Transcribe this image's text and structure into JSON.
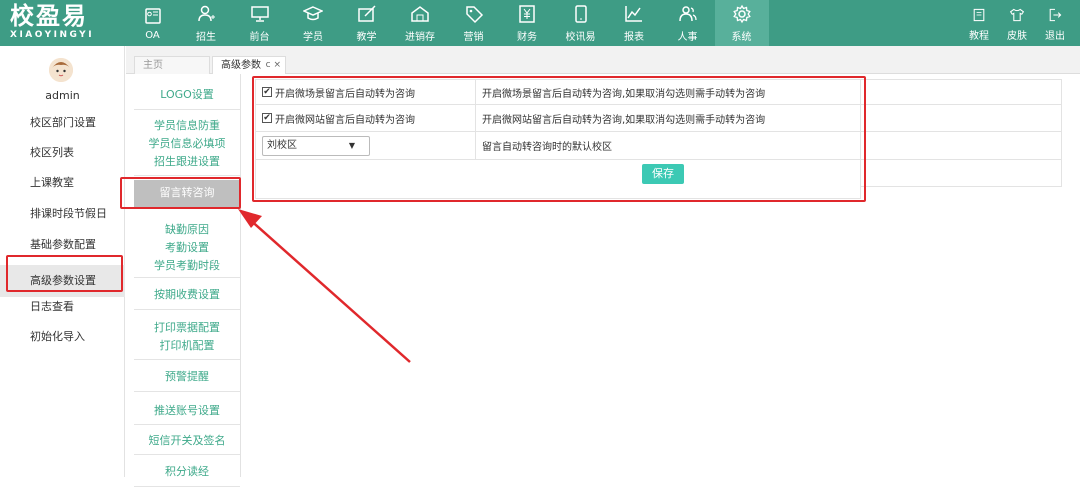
{
  "brand": {
    "name": "校盈易",
    "sub": "XIAOYINGYI"
  },
  "nav": [
    {
      "label": "OA",
      "icon": "id-card-icon"
    },
    {
      "label": "招生",
      "icon": "user-add-icon"
    },
    {
      "label": "前台",
      "icon": "monitor-icon"
    },
    {
      "label": "学员",
      "icon": "graduation-cap-icon"
    },
    {
      "label": "教学",
      "icon": "pencil-board-icon"
    },
    {
      "label": "进销存",
      "icon": "warehouse-icon"
    },
    {
      "label": "营销",
      "icon": "tag-icon"
    },
    {
      "label": "财务",
      "icon": "yen-icon"
    },
    {
      "label": "校讯易",
      "icon": "phone-icon"
    },
    {
      "label": "报表",
      "icon": "line-chart-icon"
    },
    {
      "label": "人事",
      "icon": "people-icon"
    },
    {
      "label": "系统",
      "icon": "gear-icon"
    }
  ],
  "tools": [
    {
      "label": "教程",
      "icon": "book-icon"
    },
    {
      "label": "皮肤",
      "icon": "shirt-icon"
    },
    {
      "label": "退出",
      "icon": "logout-icon"
    }
  ],
  "user": {
    "name": "admin"
  },
  "sidebar": [
    {
      "label": "校区部门设置"
    },
    {
      "label": "校区列表"
    },
    {
      "label": "上课教室"
    },
    {
      "label": "排课时段节假日"
    },
    {
      "label": "基础参数配置"
    },
    {
      "label": "高级参数设置"
    },
    {
      "label": "日志查看"
    },
    {
      "label": "初始化导入"
    }
  ],
  "tabs": {
    "home": "主页",
    "current": "高级参数",
    "refresh": "c",
    "close": "×"
  },
  "submenu": [
    [
      "LOGO设置"
    ],
    [
      "学员信息防重",
      "学员信息必填项",
      "招生跟进设置"
    ],
    [
      "留言转咨询"
    ],
    [
      "缺勤原因",
      "考勤设置",
      "学员考勤时段"
    ],
    [
      "按期收费设置"
    ],
    [
      "打印票据配置",
      "打印机配置"
    ],
    [
      "预警提醒"
    ],
    [
      "推送账号设置"
    ],
    [
      "短信开关及签名"
    ],
    [
      "积分读经"
    ]
  ],
  "settings": {
    "row1": {
      "label": "开启微场景留言后自动转为咨询",
      "desc": "开启微场景留言后自动转为咨询,如果取消勾选则需手动转为咨询",
      "checked": true
    },
    "row2": {
      "label": "开启微网站留言后自动转为咨询",
      "desc": "开启微网站留言后自动转为咨询,如果取消勾选则需手动转为咨询",
      "checked": true
    },
    "row3": {
      "value": "刘校区",
      "desc": "留言自动转咨询时的默认校区"
    },
    "save": "保存"
  },
  "colors": {
    "topbar": "#3e9c85",
    "accent": "#3ea98a",
    "save": "#3cc9b4",
    "annotation": "#e0282c"
  }
}
